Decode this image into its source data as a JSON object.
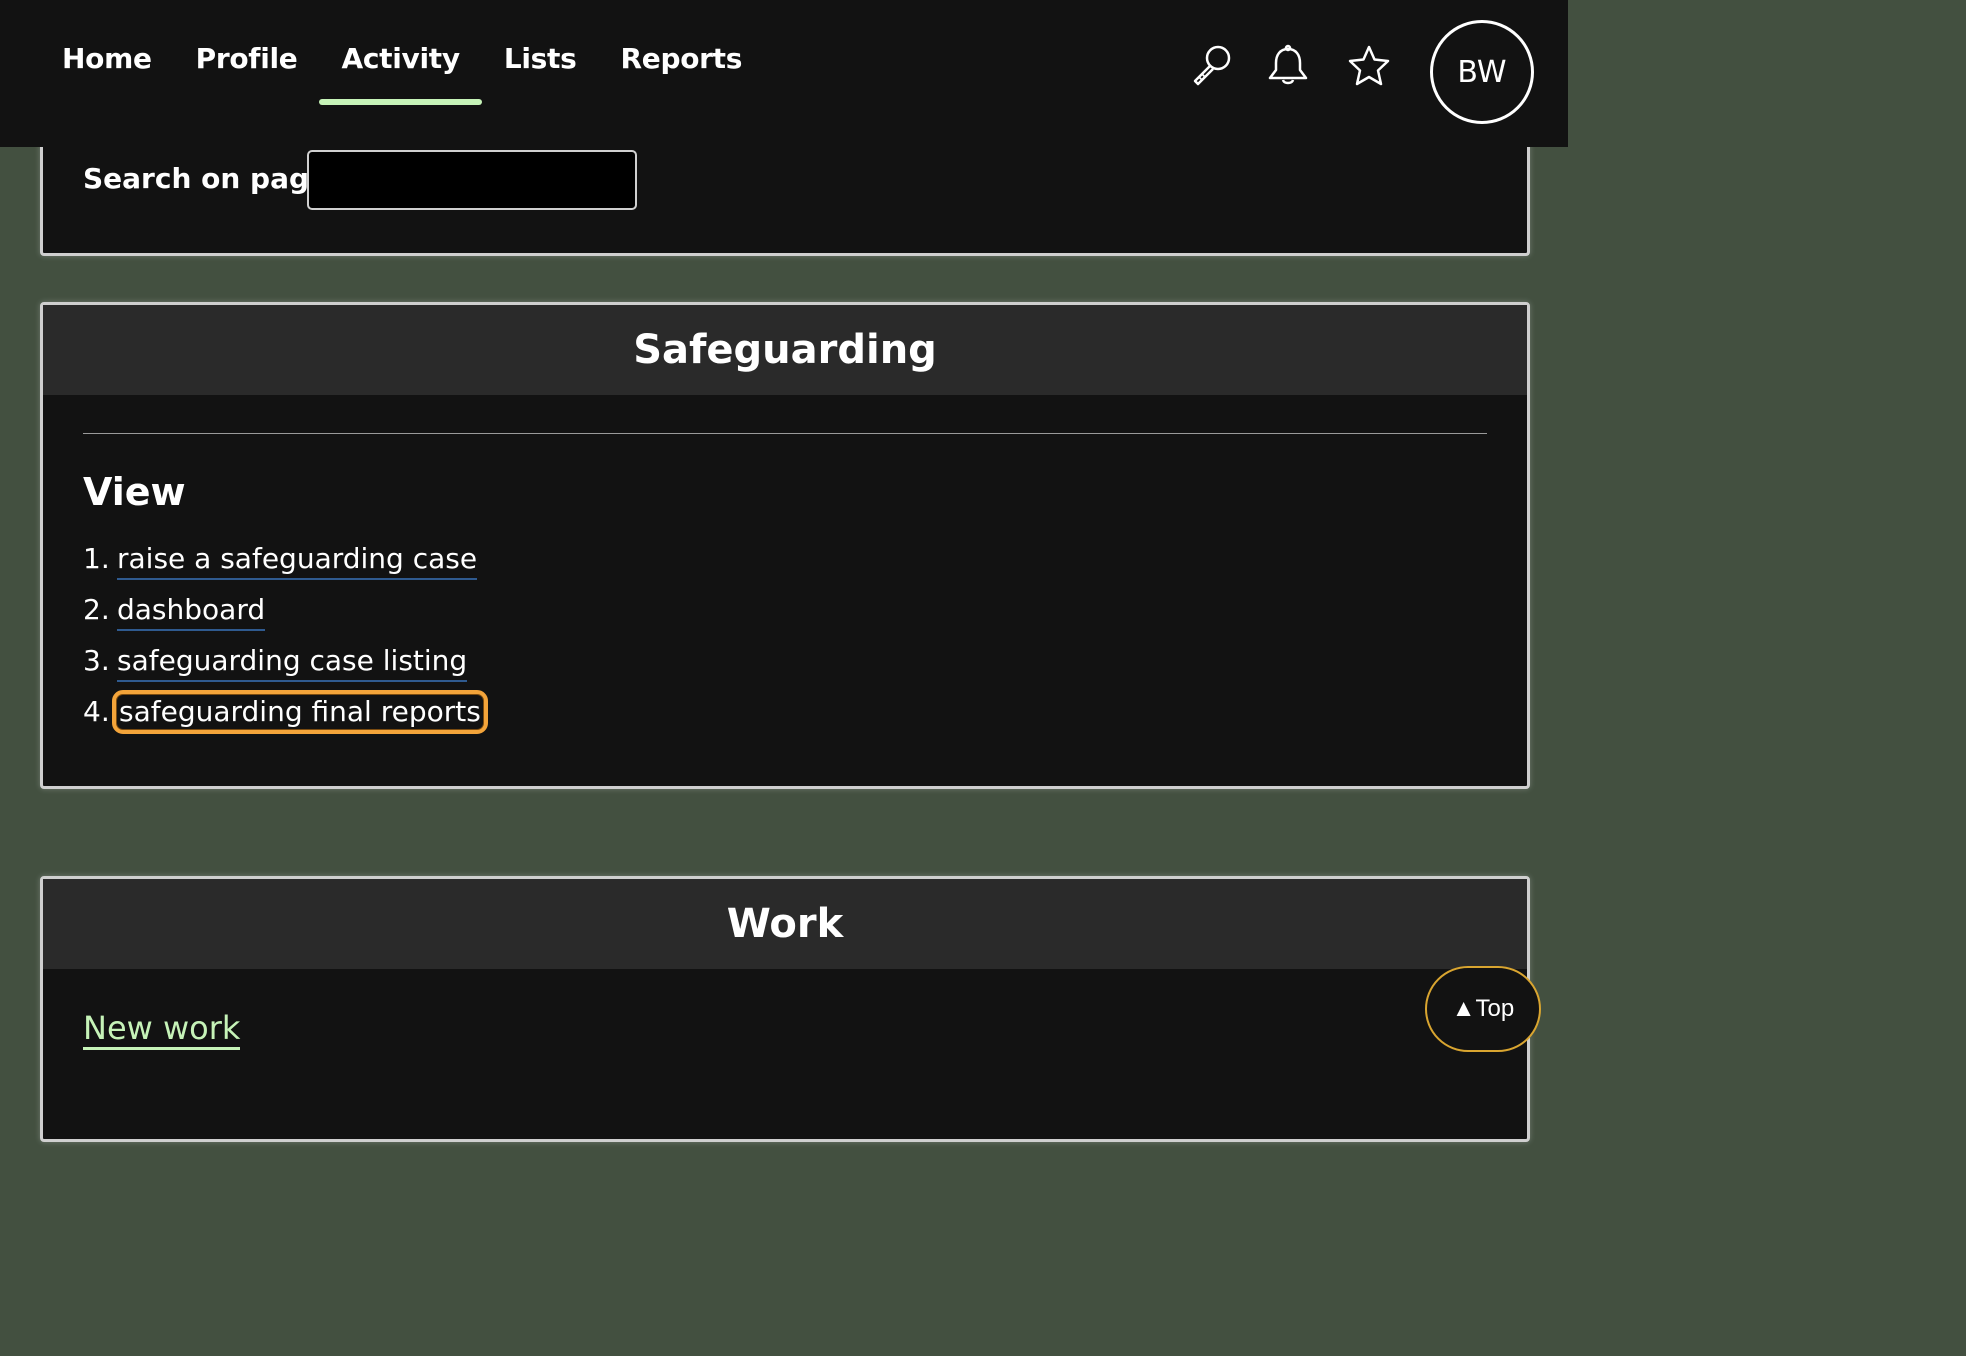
{
  "nav": {
    "items": [
      {
        "label": "Home"
      },
      {
        "label": "Profile"
      },
      {
        "label": "Activity",
        "active": true
      },
      {
        "label": "Lists"
      },
      {
        "label": "Reports"
      }
    ],
    "icons": [
      "search-icon",
      "bell-icon",
      "star-icon"
    ],
    "avatar_initials": "BW"
  },
  "search": {
    "label": "Search on page",
    "value": ""
  },
  "safeguarding": {
    "title": "Safeguarding",
    "view_heading": "View",
    "items": [
      {
        "number": "1.",
        "label": "raise a safeguarding case"
      },
      {
        "number": "2.",
        "label": "dashboard"
      },
      {
        "number": "3.",
        "label": "safeguarding case listing"
      },
      {
        "number": "4.",
        "label": "safeguarding final reports",
        "focused": true
      }
    ]
  },
  "work": {
    "title": "Work",
    "link": "New work"
  },
  "top_button": {
    "label": "▲Top"
  },
  "colors": {
    "page_background": "#435040",
    "surface": "#121212",
    "header_surface": "#2a2a2a",
    "accent_green": "#c6f3b8",
    "focus_orange": "#f3a43a",
    "link_underline": "#2f5a8f"
  }
}
